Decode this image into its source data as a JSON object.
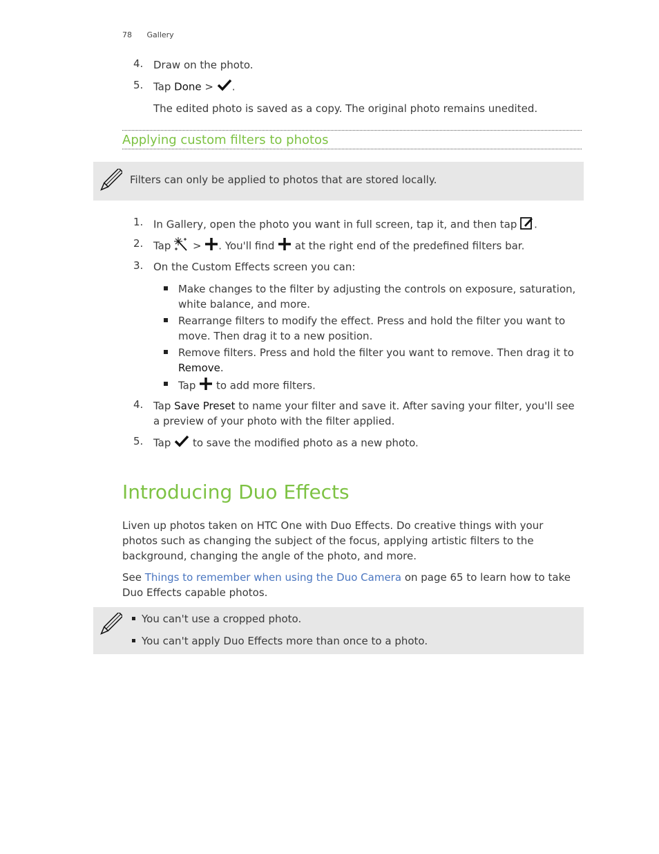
{
  "header": {
    "page_number": "78",
    "section": "Gallery"
  },
  "intro_steps": [
    {
      "num": "4.",
      "text": "Draw on the photo."
    },
    {
      "num": "5.",
      "pre": "Tap ",
      "ui": "Done",
      "post": " > ",
      "end": "."
    }
  ],
  "intro_note": "The edited photo is saved as a copy. The original photo remains unedited.",
  "section_heading": "Applying custom filters to photos",
  "note1": {
    "icon": "pencil-icon",
    "text": "Filters can only be applied to photos that are stored locally."
  },
  "steps": [
    {
      "num": "1.",
      "text": "In Gallery, open the photo you want in full screen, tap it, and then tap ",
      "end": "."
    },
    {
      "num": "2.",
      "pre": "Tap ",
      "mid": " > ",
      "mid2": ". You'll find ",
      "post": " at the right end of the predefined filters bar."
    },
    {
      "num": "3.",
      "text": "On the Custom Effects screen you can:"
    },
    {
      "num": "4.",
      "pre": "Tap ",
      "ui": "Save Preset",
      "post": " to name your filter and save it. After saving your filter, you'll see a preview of your photo with the filter applied."
    },
    {
      "num": "5.",
      "pre": "Tap ",
      "post": " to save the modified photo as a new photo."
    }
  ],
  "bullets": [
    {
      "text": "Make changes to the filter by adjusting the controls on exposure, saturation, white balance, and more."
    },
    {
      "text": "Rearrange filters to modify the effect. Press and hold the filter you want to move. Then drag it to a new position."
    },
    {
      "pre": "Remove filters. Press and hold the filter you want to remove. Then drag it to ",
      "ui": "Remove",
      "post": "."
    },
    {
      "pre": "Tap ",
      "post": " to add more filters."
    }
  ],
  "duo": {
    "heading": "Introducing Duo Effects",
    "para1": "Liven up photos taken on HTC One with Duo Effects. Do creative things with your photos such as changing the subject of the focus, applying artistic filters to the background, changing the angle of the photo, and more.",
    "para2_pre": "See ",
    "para2_link": "Things to remember when using the Duo Camera",
    "para2_post": " on page 65 to learn how to take Duo Effects capable photos.",
    "notes": [
      "You can't use a cropped photo.",
      "You can't apply Duo Effects more than once to a photo."
    ]
  },
  "colors": {
    "heading_green": "#7dc243",
    "link_blue": "#4a76c0",
    "note_bg": "#e7e7e7"
  }
}
